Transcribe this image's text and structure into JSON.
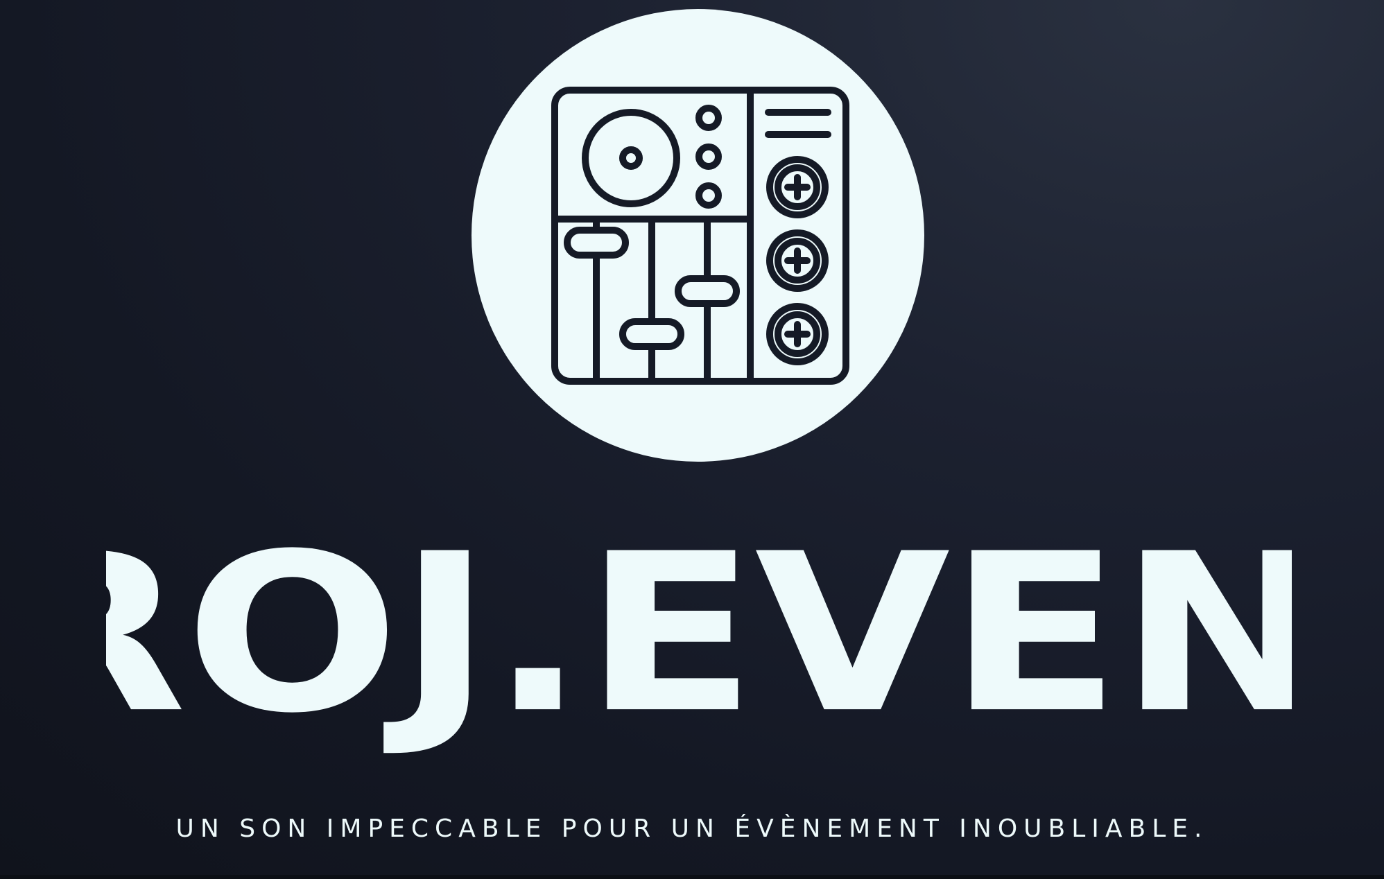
{
  "brand": {
    "name": "PROJ.EVENTSON",
    "tagline": "UN SON IMPECCABLE POUR UN ÉVÈNEMENT INOUBLIABLE.",
    "logo_icon": "mixing-console-icon"
  },
  "colors": {
    "background": "#151a26",
    "foreground": "#eefafb",
    "icon_stroke": "#151a26"
  }
}
